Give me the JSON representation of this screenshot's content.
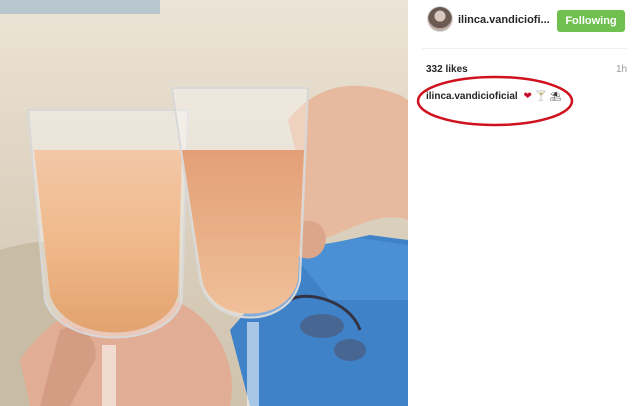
{
  "post": {
    "photo_alt": "two champagne glasses on the beach",
    "account": {
      "username": "ilinca.vandiciofi...",
      "follow_label": "Following"
    },
    "stats": {
      "likes": "332 likes",
      "time": "1h"
    },
    "caption": {
      "username": "ilinca.vandicioficial",
      "emoji": [
        "heart-emoji",
        "cocktail-emoji",
        "beach-umbrella-emoji"
      ]
    }
  },
  "colors": {
    "follow_button": "#70c050",
    "annotation_circle": "#d0121e"
  }
}
